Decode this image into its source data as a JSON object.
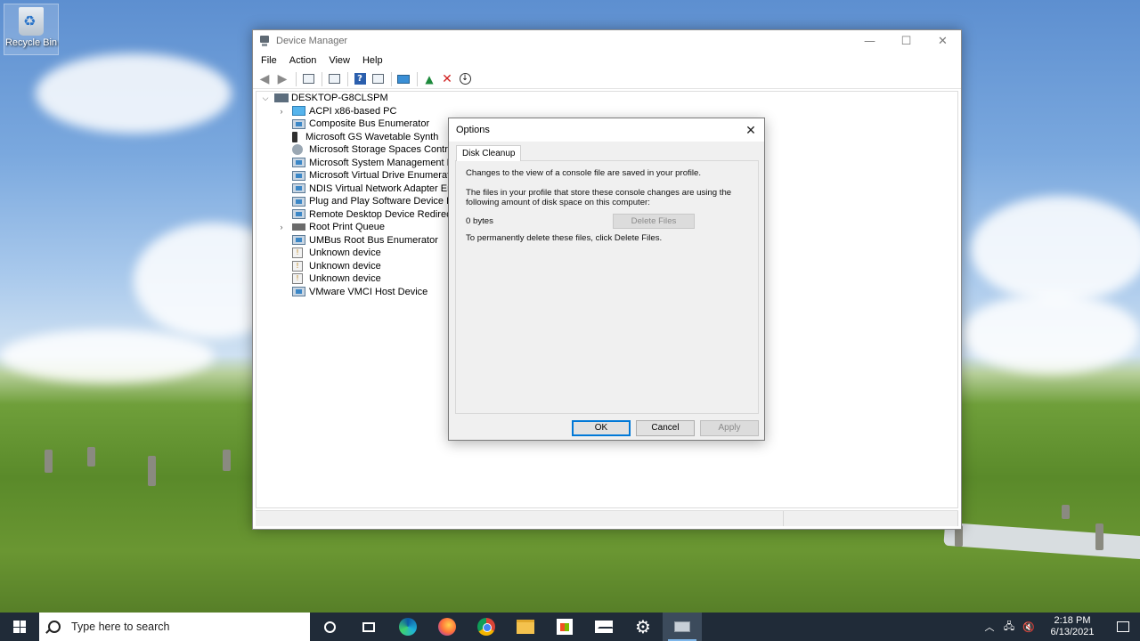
{
  "desktop": {
    "recycle_bin_label": "Recycle Bin"
  },
  "device_manager": {
    "title": "Device Manager",
    "menu": [
      "File",
      "Action",
      "View",
      "Help"
    ],
    "tree": {
      "root": "DESKTOP-G8CLSPM",
      "items": [
        {
          "label": "ACPI x86-based PC",
          "expandable": true,
          "icon": "computer-icon"
        },
        {
          "label": "Composite Bus Enumerator",
          "expandable": false,
          "icon": "system-device-icon"
        },
        {
          "label": "Microsoft GS Wavetable Synth",
          "expandable": false,
          "icon": "sound-device-icon"
        },
        {
          "label": "Microsoft Storage Spaces Controll",
          "expandable": false,
          "icon": "storage-controller-icon"
        },
        {
          "label": "Microsoft System Management BI",
          "expandable": false,
          "icon": "system-device-icon"
        },
        {
          "label": "Microsoft Virtual Drive Enumerato",
          "expandable": false,
          "icon": "system-device-icon"
        },
        {
          "label": "NDIS Virtual Network Adapter Enu",
          "expandable": false,
          "icon": "system-device-icon"
        },
        {
          "label": "Plug and Play Software Device Enu",
          "expandable": false,
          "icon": "system-device-icon"
        },
        {
          "label": "Remote Desktop Device Redirector",
          "expandable": false,
          "icon": "system-device-icon"
        },
        {
          "label": "Root Print Queue",
          "expandable": true,
          "icon": "printer-icon"
        },
        {
          "label": "UMBus Root Bus Enumerator",
          "expandable": false,
          "icon": "system-device-icon"
        },
        {
          "label": "Unknown device",
          "expandable": false,
          "icon": "unknown-device-icon"
        },
        {
          "label": "Unknown device",
          "expandable": false,
          "icon": "unknown-device-icon"
        },
        {
          "label": "Unknown device",
          "expandable": false,
          "icon": "unknown-device-icon"
        },
        {
          "label": "VMware VMCI Host Device",
          "expandable": false,
          "icon": "system-device-icon"
        }
      ]
    }
  },
  "options_dialog": {
    "title": "Options",
    "close_glyph": "✕",
    "tab_label": "Disk Cleanup",
    "text_profile": "Changes to the view of a console file are saved in your profile.",
    "text_files": "The files in your profile that store these console changes are using the following amount of disk space on this computer:",
    "size_value": "0 bytes",
    "delete_files_label": "Delete Files",
    "text_delete": "To permanently delete these files, click Delete Files.",
    "ok_label": "OK",
    "cancel_label": "Cancel",
    "apply_label": "Apply"
  },
  "taskbar": {
    "search_placeholder": "Type here to search",
    "time": "2:18 PM",
    "date": "6/13/2021"
  },
  "colors": {
    "accent": "#0078d7",
    "taskbar": "#202b38"
  }
}
